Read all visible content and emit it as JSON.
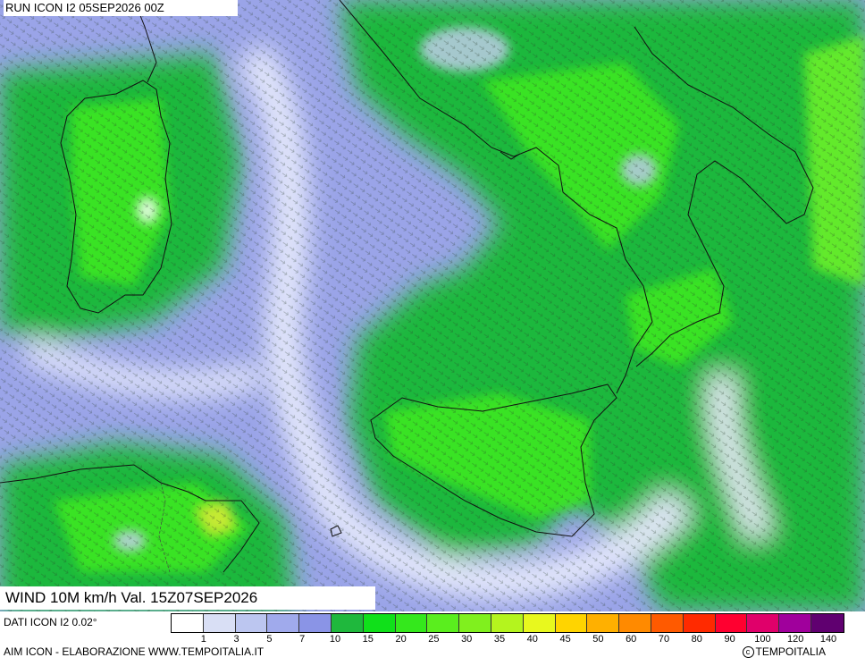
{
  "header": {
    "run_label": "RUN ICON I2 05SEP2026 00Z"
  },
  "map": {
    "valid_label": "WIND 10M km/h Val. 15Z07SEP2026"
  },
  "footer": {
    "data_source": "DATI ICON I2 0.02°",
    "credit": "AIM ICON - ELABORAZIONE WWW.TEMPOITALIA.IT",
    "brand": "TEMPOITALIA"
  },
  "legend": {
    "colors": [
      "#ffffff",
      "#d9dff5",
      "#bcc6f0",
      "#a0aaec",
      "#8a94e6",
      "#1fb83d",
      "#10e01a",
      "#34e81c",
      "#5aee1e",
      "#80f01e",
      "#b4f41e",
      "#e8f81e",
      "#ffd400",
      "#ffb000",
      "#ff8a00",
      "#ff5a00",
      "#ff2a00",
      "#ff0030",
      "#e0006a",
      "#a0009c",
      "#600070"
    ],
    "ticks": [
      "1",
      "3",
      "5",
      "7",
      "10",
      "15",
      "20",
      "25",
      "30",
      "35",
      "40",
      "45",
      "50",
      "60",
      "70",
      "80",
      "90",
      "100",
      "120",
      "140"
    ]
  }
}
